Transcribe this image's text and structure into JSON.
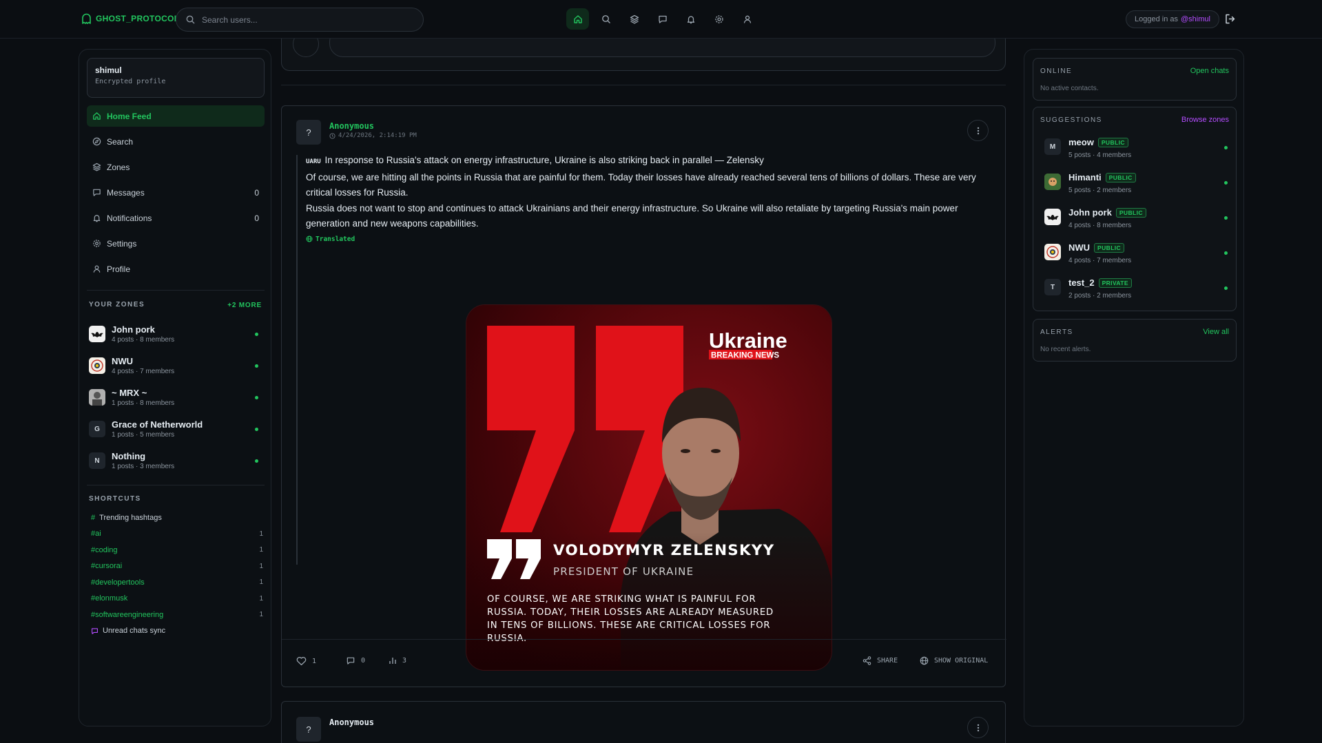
{
  "app": {
    "brand": "GHOST_PROTOCOL"
  },
  "search": {
    "placeholder": "Search users..."
  },
  "session": {
    "prefix": "Logged in as",
    "handle": "@shimul"
  },
  "profile": {
    "name": "shimul",
    "subtitle": "Encrypted profile"
  },
  "nav": [
    {
      "label": "Home Feed",
      "icon": "home-icon",
      "count": ""
    },
    {
      "label": "Search",
      "icon": "compass-icon",
      "count": ""
    },
    {
      "label": "Zones",
      "icon": "layers-icon",
      "count": ""
    },
    {
      "label": "Messages",
      "icon": "message-icon",
      "count": "0"
    },
    {
      "label": "Notifications",
      "icon": "bell-icon",
      "count": "0"
    },
    {
      "label": "Settings",
      "icon": "gear-icon",
      "count": ""
    },
    {
      "label": "Profile",
      "icon": "user-icon",
      "count": ""
    }
  ],
  "your_zones": {
    "heading": "YOUR ZONES",
    "more": "+2 MORE",
    "items": [
      {
        "name": "John pork",
        "meta": "4 posts · 8 members",
        "avatar": ""
      },
      {
        "name": "NWU",
        "meta": "4 posts · 7 members",
        "avatar": ""
      },
      {
        "name": "~ MRX ~",
        "meta": "1 posts · 8 members",
        "avatar": ""
      },
      {
        "name": "Grace of Netherworld",
        "meta": "1 posts · 5 members",
        "avatar": "G"
      },
      {
        "name": "Nothing",
        "meta": "1 posts · 3 members",
        "avatar": "N"
      }
    ]
  },
  "shortcuts": {
    "heading": "SHORTCUTS",
    "trending": "Trending hashtags",
    "tags": [
      {
        "tag": "#ai",
        "count": "1"
      },
      {
        "tag": "#coding",
        "count": "1"
      },
      {
        "tag": "#cursorai",
        "count": "1"
      },
      {
        "tag": "#developertools",
        "count": "1"
      },
      {
        "tag": "#elonmusk",
        "count": "1"
      },
      {
        "tag": "#softwareengineering",
        "count": "1"
      }
    ],
    "unread": "Unread chats sync"
  },
  "post": {
    "avatar": "?",
    "author": "Anonymous",
    "timestamp": "4/24/2026, 2:14:19 PM",
    "lang_tag": "UARU",
    "line1": "In response to Russia's attack on energy infrastructure, Ukraine is also striking back in parallel — Zelensky",
    "line2": "Of course, we are hitting all the points in Russia that are painful for them. Today their losses have already reached several tens of billions of dollars. These are very critical losses for Russia.",
    "line3": "Russia does not want to stop and continues to attack Ukrainians and their energy infrastructure. So Ukraine will also retaliate by targeting Russia's main power generation and new weapons capabilities.",
    "translated": "Translated",
    "image": {
      "brand_top": "Ukraine",
      "brand_bottom": "BREAKING NEWS",
      "speaker": "VOLODYMYR ZELENSKYY",
      "role": "PRESIDENT OF UKRAINE",
      "quote_l1": "OF COURSE, WE ARE STRIKING WHAT IS PAINFUL FOR",
      "quote_l2": "RUSSIA. TODAY, THEIR LOSSES ARE ALREADY MEASURED",
      "quote_l3": "IN TENS OF BILLIONS. THESE ARE CRITICAL LOSSES FOR",
      "quote_l4": "RUSSIA."
    },
    "likes": "1",
    "comments": "0",
    "views": "3",
    "share": "SHARE",
    "show_original": "SHOW ORIGINAL"
  },
  "post2": {
    "avatar": "?",
    "author": "Anonymous"
  },
  "online": {
    "heading": "ONLINE",
    "link": "Open chats",
    "empty": "No active contacts."
  },
  "suggestions": {
    "heading": "SUGGESTIONS",
    "link": "Browse zones",
    "items": [
      {
        "name": "meow",
        "badge": "PUBLIC",
        "meta": "5 posts · 4 members",
        "avatar": "M"
      },
      {
        "name": "Himanti",
        "badge": "PUBLIC",
        "meta": "5 posts · 2 members",
        "avatar": ""
      },
      {
        "name": "John pork",
        "badge": "PUBLIC",
        "meta": "4 posts · 8 members",
        "avatar": ""
      },
      {
        "name": "NWU",
        "badge": "PUBLIC",
        "meta": "4 posts · 7 members",
        "avatar": ""
      },
      {
        "name": "test_2",
        "badge": "PRIVATE",
        "meta": "2 posts · 2 members",
        "avatar": "T"
      }
    ]
  },
  "alerts": {
    "heading": "ALERTS",
    "link": "View all",
    "empty": "No recent alerts."
  },
  "colors": {
    "accent": "#22c55e",
    "purple": "#b44dff",
    "background": "#0b0e12"
  }
}
